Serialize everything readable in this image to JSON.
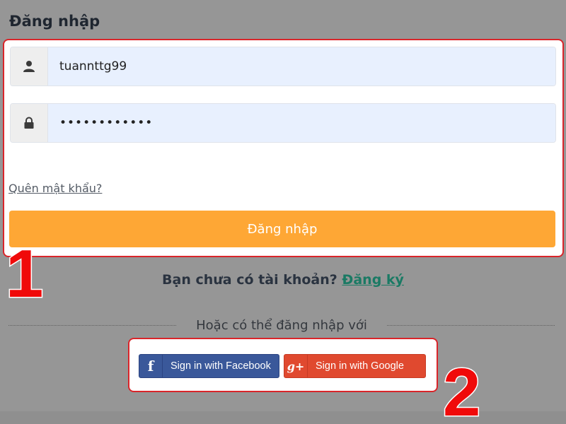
{
  "title": "Đăng nhập",
  "username": {
    "value": "tuannttg99",
    "icon": "user-icon"
  },
  "password": {
    "value": "••••••••••••",
    "icon": "lock-icon"
  },
  "forgot_link": "Quên mật khẩu?",
  "login_button": "Đăng nhập",
  "markers": {
    "one": "1",
    "two": "2"
  },
  "signup": {
    "prompt": "Bạn chưa có tài khoản?",
    "link": "Đăng ký"
  },
  "divider_text": "Hoặc có thể đăng nhập với",
  "social": {
    "facebook": {
      "icon": "f",
      "label": "Sign in with Facebook",
      "color": "#3a589a"
    },
    "google": {
      "icon": "g+",
      "label": "Sign in with Google",
      "color": "#e0492f"
    }
  },
  "colors": {
    "accent": "#fea735",
    "highlight": "#d9252a",
    "link": "#1a7a64"
  }
}
